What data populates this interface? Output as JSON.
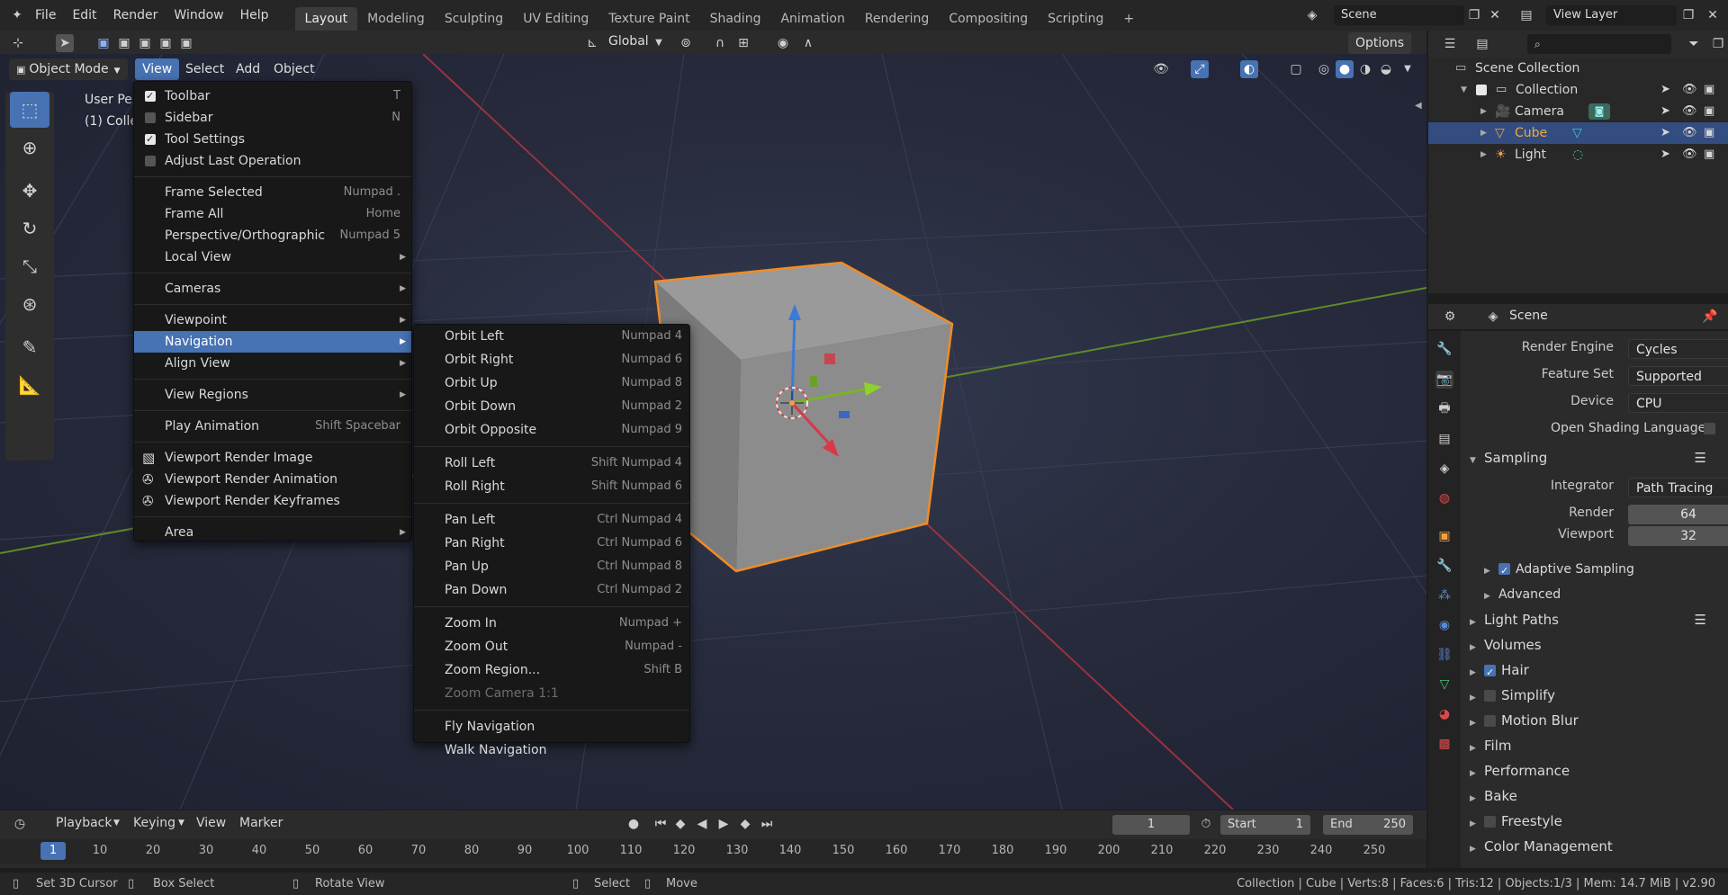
{
  "topbar": {
    "menus": [
      "File",
      "Edit",
      "Render",
      "Window",
      "Help"
    ],
    "workspaces": [
      "Layout",
      "Modeling",
      "Sculpting",
      "UV Editing",
      "Texture Paint",
      "Shading",
      "Animation",
      "Rendering",
      "Compositing",
      "Scripting"
    ],
    "active_workspace": "Layout",
    "scene": "Scene",
    "view_layer": "View Layer"
  },
  "viewport_header": {
    "mode": "Object Mode",
    "menus": [
      "View",
      "Select",
      "Add",
      "Object"
    ],
    "transform_orientation": "Global",
    "options": "Options",
    "overlay_text_1": "User Persp",
    "overlay_text_2": "(1) Collection | Cube"
  },
  "view_menu": {
    "items": [
      {
        "label": "Toolbar",
        "shortcut": "T",
        "check": true
      },
      {
        "label": "Sidebar",
        "shortcut": "N",
        "check": false
      },
      {
        "label": "Tool Settings",
        "shortcut": "",
        "check": true
      },
      {
        "label": "Adjust Last Operation",
        "shortcut": "",
        "check": false
      },
      {
        "label": "Frame Selected",
        "shortcut": "Numpad ."
      },
      {
        "label": "Frame All",
        "shortcut": "Home"
      },
      {
        "label": "Perspective/Orthographic",
        "shortcut": "Numpad 5"
      },
      {
        "label": "Local View",
        "shortcut": ""
      },
      {
        "label": "Cameras",
        "shortcut": ""
      },
      {
        "label": "Viewpoint",
        "shortcut": ""
      },
      {
        "label": "Navigation",
        "shortcut": ""
      },
      {
        "label": "Align View",
        "shortcut": ""
      },
      {
        "label": "View Regions",
        "shortcut": ""
      },
      {
        "label": "Play Animation",
        "shortcut": "Shift Spacebar"
      },
      {
        "label": "Viewport Render Image",
        "shortcut": ""
      },
      {
        "label": "Viewport Render Animation",
        "shortcut": ""
      },
      {
        "label": "Viewport Render Keyframes",
        "shortcut": ""
      },
      {
        "label": "Area",
        "shortcut": ""
      }
    ]
  },
  "navigation_menu": {
    "items": [
      {
        "label": "Orbit Left",
        "shortcut": "Numpad 4"
      },
      {
        "label": "Orbit Right",
        "shortcut": "Numpad 6"
      },
      {
        "label": "Orbit Up",
        "shortcut": "Numpad 8"
      },
      {
        "label": "Orbit Down",
        "shortcut": "Numpad 2"
      },
      {
        "label": "Orbit Opposite",
        "shortcut": "Numpad 9"
      },
      {
        "label": "Roll Left",
        "shortcut": "Shift Numpad 4"
      },
      {
        "label": "Roll Right",
        "shortcut": "Shift Numpad 6"
      },
      {
        "label": "Pan Left",
        "shortcut": "Ctrl Numpad 4"
      },
      {
        "label": "Pan Right",
        "shortcut": "Ctrl Numpad 6"
      },
      {
        "label": "Pan Up",
        "shortcut": "Ctrl Numpad 8"
      },
      {
        "label": "Pan Down",
        "shortcut": "Ctrl Numpad 2"
      },
      {
        "label": "Zoom In",
        "shortcut": "Numpad +"
      },
      {
        "label": "Zoom Out",
        "shortcut": "Numpad -"
      },
      {
        "label": "Zoom Region...",
        "shortcut": "Shift B"
      },
      {
        "label": "Zoom Camera 1:1",
        "shortcut": ""
      },
      {
        "label": "Fly Navigation",
        "shortcut": ""
      },
      {
        "label": "Walk Navigation",
        "shortcut": ""
      }
    ]
  },
  "outliner": {
    "root": "Scene Collection",
    "collection": "Collection",
    "objects": [
      "Camera",
      "Cube",
      "Light"
    ]
  },
  "properties": {
    "title": "Scene",
    "render_engine_label": "Render Engine",
    "render_engine": "Cycles",
    "feature_set_label": "Feature Set",
    "feature_set": "Supported",
    "device_label": "Device",
    "device": "CPU",
    "osl_label": "Open Shading Language",
    "sampling": "Sampling",
    "integrator_label": "Integrator",
    "integrator": "Path Tracing",
    "render_label": "Render",
    "render_samples": "64",
    "viewport_label": "Viewport",
    "viewport_samples": "32",
    "adaptive_sampling": "Adaptive Sampling",
    "advanced": "Advanced",
    "panels": [
      "Light Paths",
      "Volumes",
      "Hair",
      "Simplify",
      "Motion Blur",
      "Film",
      "Performance",
      "Bake",
      "Freestyle",
      "Color Management"
    ]
  },
  "timeline": {
    "menus": [
      "Playback",
      "Keying",
      "View",
      "Marker"
    ],
    "current_frame": "1",
    "start_label": "Start",
    "start": "1",
    "end_label": "End",
    "end": "250",
    "ticks": [
      "1",
      "10",
      "20",
      "30",
      "40",
      "50",
      "60",
      "70",
      "80",
      "90",
      "100",
      "110",
      "120",
      "130",
      "140",
      "150",
      "160",
      "170",
      "180",
      "190",
      "200",
      "210",
      "220",
      "230",
      "240",
      "250"
    ]
  },
  "statusbar": {
    "hint1": "Set 3D Cursor",
    "hint2": "Box Select",
    "hint3": "Rotate View",
    "hint4": "Select",
    "hint5": "Move",
    "stats": "Collection | Cube | Verts:8 | Faces:6 | Tris:12 | Objects:1/3 | Mem: 14.7 MiB | v2.90"
  }
}
